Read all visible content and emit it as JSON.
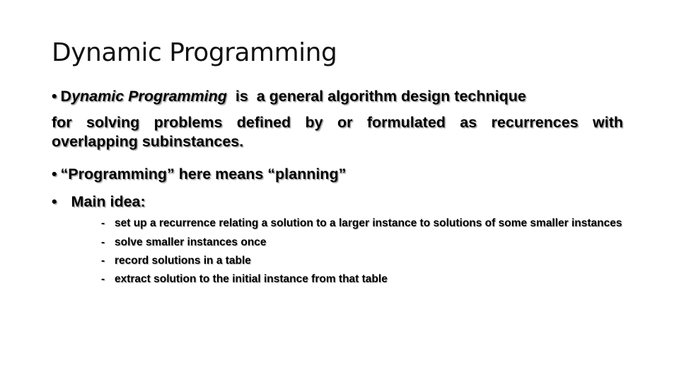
{
  "slide": {
    "title": "Dynamic Programming",
    "bullet_glyph": "•",
    "para1": {
      "prefix": "D",
      "emphasis": "ynamic Programming",
      "line1_rest": "  is  a general algorithm design technique",
      "line2": "for solving problems defined by or formulated as recurrences with",
      "line3": "overlapping subinstances."
    },
    "para2": "“Programming” here means “planning”",
    "para3": "Main idea:",
    "sub_dash": "-",
    "sub_items": [
      "set up a recurrence relating a solution to a larger instance  to solutions of some smaller instances",
      "solve smaller instances once",
      "record solutions in a table",
      "extract solution to the initial instance from that table"
    ]
  }
}
